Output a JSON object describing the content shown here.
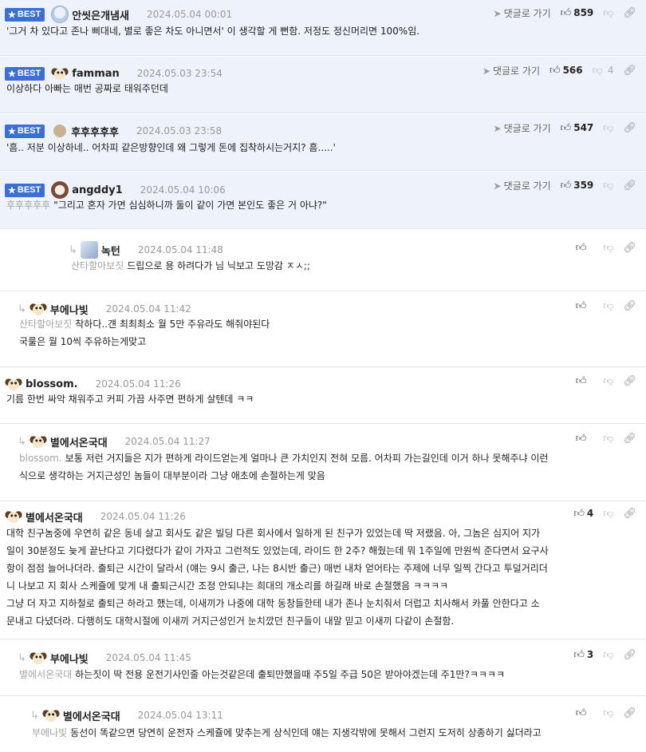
{
  "reply_to_label": "댓글로 가기",
  "comments": [
    {
      "best": true,
      "best_label": "BEST",
      "avatar": "cat",
      "nick": "안씻은개냄새",
      "date": "2024.05.04 00:01",
      "up": "859",
      "down": "",
      "show_goto": true,
      "mention": "",
      "lines": [
        "'그거 차 있다고 존나 삐대네, 별로 좋은 차도 아니면서' 이 생각할 게 뻔함. 저정도 정신머리면 100%임."
      ]
    },
    {
      "best": true,
      "best_label": "BEST",
      "avatar": "dog",
      "nick": "famman",
      "date": "2024.05.03 23:54",
      "up": "566",
      "down": "4",
      "show_goto": true,
      "mention": "",
      "lines": [
        "이상하다 아빠는 매번 공짜로 태워주던데"
      ]
    },
    {
      "best": true,
      "best_label": "BEST",
      "avatar": "ball",
      "nick": "후후후후후",
      "date": "2024.05.03 23:58",
      "up": "547",
      "down": "",
      "show_goto": true,
      "mention": "",
      "lines": [
        "'흠.. 저분 이상하네.. 어차피 같은방향인데 왜 그렇게 돈에 집착하시는거지? 흠.....'"
      ]
    },
    {
      "best": true,
      "best_label": "BEST",
      "avatar": "face",
      "nick": "angddy1",
      "date": "2024.05.04 10:06",
      "up": "359",
      "down": "",
      "show_goto": true,
      "mention": "후후후후후",
      "lines": [
        "\"그리고 혼자 가면 심심하니까 둘이 같이 가면 본인도 좋은 거 아냐?\""
      ]
    },
    {
      "best": false,
      "avatar": "bot",
      "nick": "녹턴",
      "date": "2024.05.04 11:48",
      "up": "",
      "down": "",
      "show_goto": false,
      "mention": "산타할아보짓",
      "lines": [
        "드립으로 용 하려다가 님 닉보고 도망감 ㅈㅅ;;"
      ]
    },
    {
      "best": false,
      "avatar": "dog",
      "nick": "부에나빛",
      "date": "2024.05.04 11:42",
      "up": "",
      "down": "",
      "show_goto": false,
      "mention": "산타할아보짓",
      "lines": [
        "착하다..걘 최최최소 월 5만 주유라도 해줘야된다",
        "국룰은 월 10씩 주유하는게맞고"
      ]
    },
    {
      "best": false,
      "avatar": "dog",
      "nick": "blossom.",
      "date": "2024.05.04 11:26",
      "up": "",
      "down": "",
      "show_goto": false,
      "mention": "",
      "lines": [
        "기름 한번 싸악 채워주고 커피 가끔 사주면 편하게 살텐데 ㅋㅋ"
      ]
    },
    {
      "best": false,
      "avatar": "dog",
      "nick": "별에서온국대",
      "date": "2024.05.04 11:27",
      "up": "",
      "down": "",
      "show_goto": false,
      "mention": "blossom.",
      "lines": [
        "보통 저런 거지들은 지가 편하게 라이드얻는게 얼마나 큰 가치인지 전혀 모름. 어차피 가는길인데 이거 하나 못해주냐 이런",
        "식으로 생각하는 거지근성인 놈들이 대부분이라 그냥 애초에 손절하는게 맞음"
      ]
    },
    {
      "best": false,
      "avatar": "dog",
      "nick": "별에서온국대",
      "date": "2024.05.04 11:26",
      "up": "4",
      "down": "",
      "show_goto": false,
      "mention": "",
      "lines": [
        "대학 친구놈중에 우연히 같은 동네 살고 회사도 같은 빌딩 다른 회사에서 일하게 된 친구가 있었는데 딱 저랬음. 아, 그놈은 심지어 지가",
        "일이 30분정도 늦게 끝난다고 기다렸다가 같이 가자고 그런적도 있었는데, 라이드 한 2주? 해줬는데 뭐 1주일에 만원씩 준다면서 요구사",
        "항이 점점 늘어나더라. 출퇴근 시간이 달라서 (얘는 9시 출근, 나는 8시반 출근) 매번 내차 얻어타는 주제에 너무 일찍 간다고 투덜거리더",
        "니 나보고 지 회사 스케쥴에 맞게 내 출퇴근시간 조정 안되냐는 희대의 개소리를 하길래 바로 손절했음 ㅋㅋㅋㅋ",
        "그냥 더 자고 지하철로 출퇴근 하라고 했는데, 이새끼가 나중에 대학 동창들한테 내가 존나 눈치줘서 더럽고 치사해서 카풀 안한다고 소",
        "문내고 다녔더라. 다행히도 대학시절에 이새끼 거지근성인거 눈치깠던 친구들이 내말 믿고 이새끼 다같이 손절함."
      ]
    },
    {
      "best": false,
      "avatar": "dog",
      "nick": "부에나빛",
      "date": "2024.05.04 11:45",
      "up": "3",
      "down": "",
      "show_goto": false,
      "mention": "별에서온국대",
      "lines": [
        "하는짓이 딱 전용 운전기사인줄 아는것같은데 출퇴만했을때 주5일 주급 50은 받아야겠는데 주1만?ㅋㅋㅋㅋ"
      ]
    },
    {
      "best": false,
      "avatar": "dog",
      "nick": "별에서온국대",
      "date": "2024.05.04 13:11",
      "up": "",
      "down": "",
      "show_goto": false,
      "mention": "부에나빛",
      "lines": [
        "동선이 똑같으면 당연히 운전자 스케쥴에 맞추는게 상식인데 얘는 지생각밖에 못해서 그런지 도저히 상종하기 싫더라고"
      ]
    }
  ]
}
